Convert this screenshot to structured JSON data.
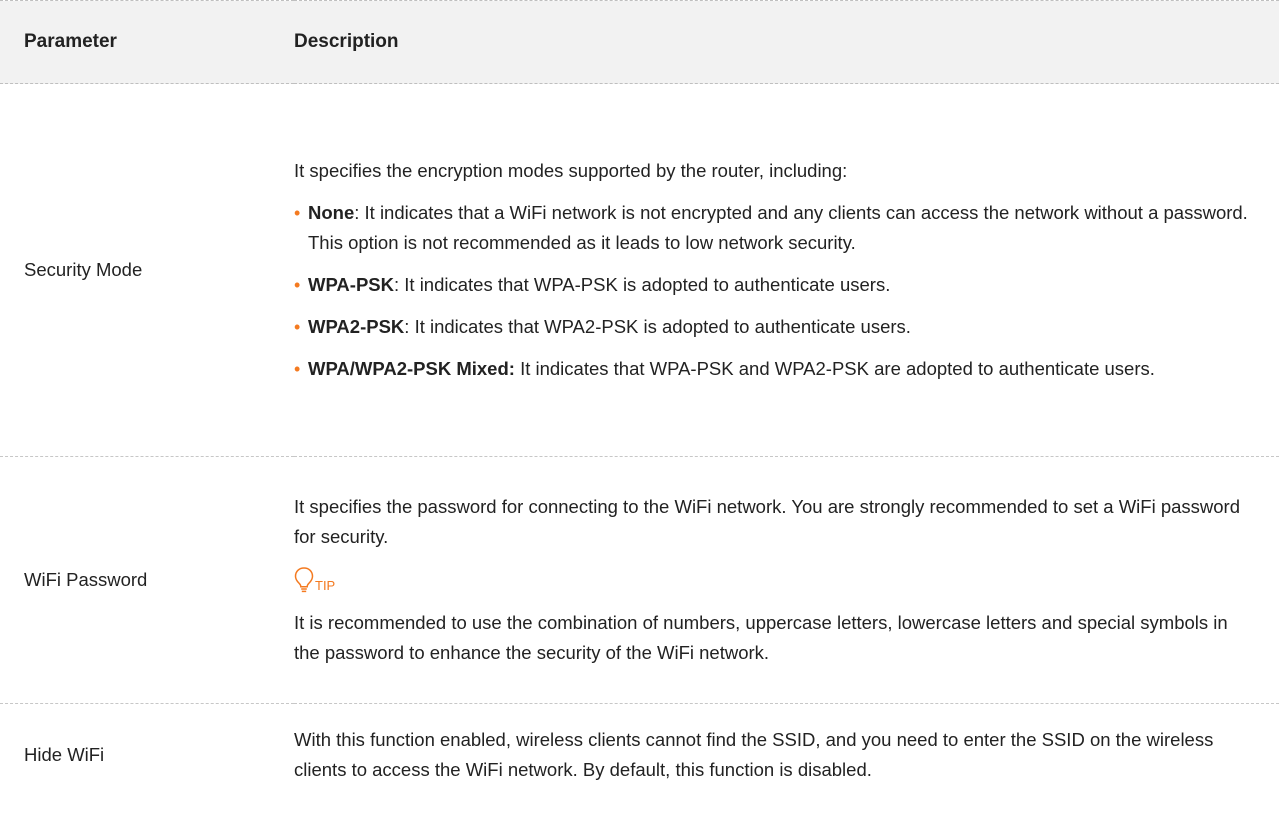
{
  "table": {
    "header": {
      "parameter": "Parameter",
      "description": "Description"
    },
    "rows": [
      {
        "parameter": "Security Mode",
        "intro": "It specifies the encryption modes supported by the router, including:",
        "items": [
          {
            "term": "None",
            "sep": ": ",
            "text": "It indicates that a WiFi network is not encrypted and any clients can access the network without a password. This option is not recommended as it leads to low network security."
          },
          {
            "term": "WPA-PSK",
            "sep": ": ",
            "text": "It indicates that WPA-PSK is adopted to authenticate users."
          },
          {
            "term": "WPA2-PSK",
            "sep": ": ",
            "text": "It indicates that WPA2-PSK is adopted to authenticate users."
          },
          {
            "term": "WPA/WPA2-PSK Mixed:",
            "sep": " ",
            "text": "It indicates that WPA-PSK and WPA2-PSK are adopted to authenticate users."
          }
        ]
      },
      {
        "parameter": "WiFi Password",
        "description": "It specifies the password for connecting to the WiFi network. You are strongly recommended to set a WiFi password for security.",
        "tip_label": "TIP",
        "tip_text": "It is recommended to use the combination of numbers, uppercase letters, lowercase letters and special symbols in the password to enhance the security of the WiFi network."
      },
      {
        "parameter": "Hide WiFi",
        "description": "With this function enabled, wireless clients cannot find the SSID, and you need to enter the SSID on the wireless clients to access the WiFi network. By default, this function is disabled."
      }
    ]
  },
  "style": {
    "accent_color": "#f47a20",
    "header_bg": "#f2f2f2",
    "bullet_glyph": "•",
    "tip_icon": "lightbulb-icon"
  }
}
